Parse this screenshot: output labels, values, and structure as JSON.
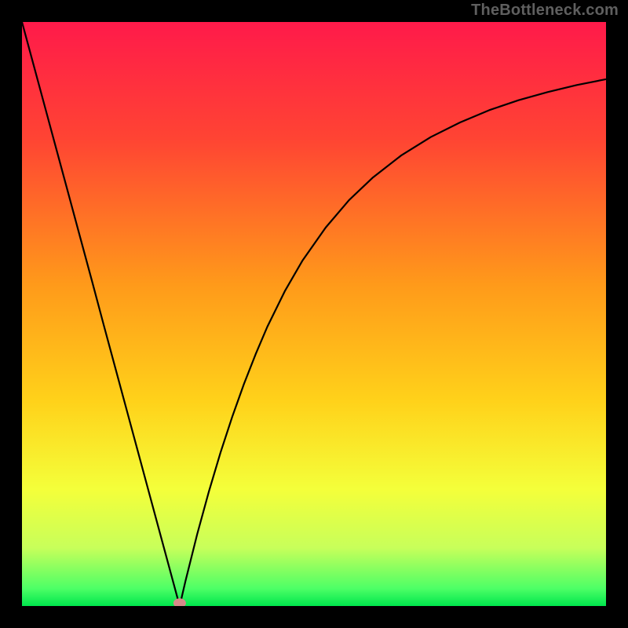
{
  "watermark": "TheBottleneck.com",
  "chart_data": {
    "type": "line",
    "title": "",
    "xlabel": "",
    "ylabel": "",
    "xlim": [
      0,
      100
    ],
    "ylim": [
      0,
      100
    ],
    "grid": false,
    "legend": false,
    "background_gradient": {
      "stops": [
        {
          "pos": 0.0,
          "color": "#ff1a4a"
        },
        {
          "pos": 0.2,
          "color": "#ff4433"
        },
        {
          "pos": 0.45,
          "color": "#ff9a1a"
        },
        {
          "pos": 0.65,
          "color": "#ffd21a"
        },
        {
          "pos": 0.8,
          "color": "#f4ff3a"
        },
        {
          "pos": 0.9,
          "color": "#c8ff5a"
        },
        {
          "pos": 0.97,
          "color": "#4dff66"
        },
        {
          "pos": 1.0,
          "color": "#00e64d"
        }
      ]
    },
    "marker": {
      "x": 27,
      "y": 0.5,
      "color": "#d68a8a"
    },
    "series": [
      {
        "name": "curve",
        "color": "#000000",
        "x": [
          0,
          2,
          4,
          6,
          8,
          10,
          12,
          14,
          16,
          18,
          20,
          22,
          24,
          26,
          27,
          28,
          30,
          32,
          34,
          36,
          38,
          40,
          42,
          45,
          48,
          52,
          56,
          60,
          65,
          70,
          75,
          80,
          85,
          90,
          95,
          100
        ],
        "y": [
          100,
          92.6,
          85.2,
          77.8,
          70.4,
          63.0,
          55.6,
          48.1,
          40.7,
          33.3,
          25.9,
          18.5,
          11.1,
          3.7,
          0.0,
          4.3,
          12.3,
          19.6,
          26.3,
          32.4,
          38.0,
          43.1,
          47.8,
          53.9,
          59.1,
          64.8,
          69.5,
          73.3,
          77.2,
          80.3,
          82.8,
          84.9,
          86.6,
          88.0,
          89.2,
          90.2
        ]
      }
    ]
  }
}
